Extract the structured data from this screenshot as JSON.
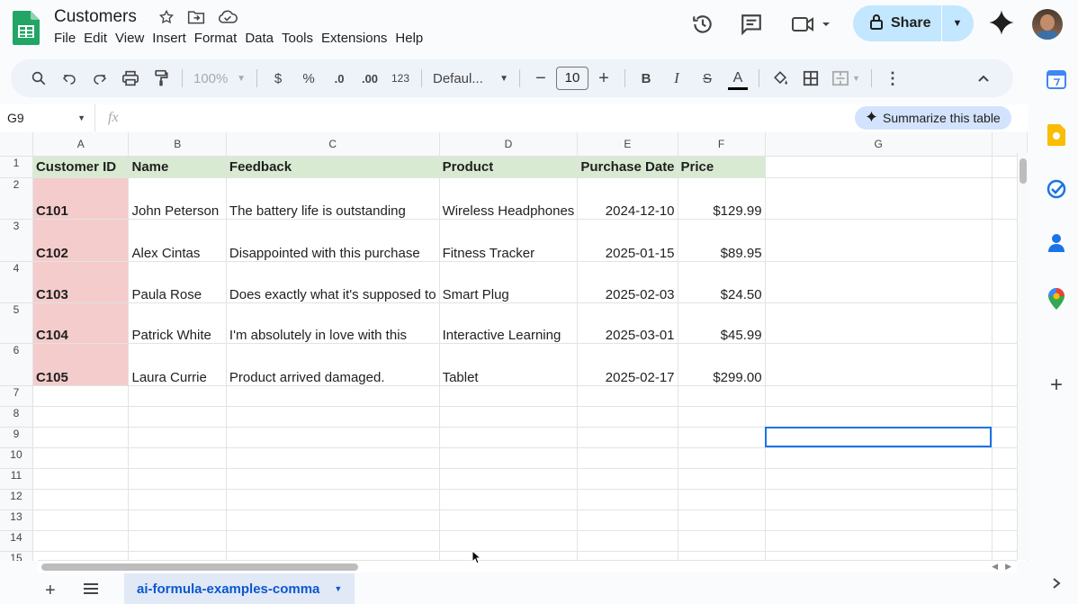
{
  "app": {
    "doc_title": "Customers",
    "menu": [
      "File",
      "Edit",
      "View",
      "Insert",
      "Format",
      "Data",
      "Tools",
      "Extensions",
      "Help"
    ],
    "share_label": "Share"
  },
  "toolbar": {
    "zoom": "100%",
    "currency": "$",
    "percent": "%",
    "dec_decrease": ".0",
    "dec_increase": ".00",
    "number_format": "123",
    "font": "Defaul...",
    "font_size": "10",
    "bold": "B",
    "italic": "I",
    "strike": "S",
    "text_color": "A"
  },
  "formula_bar": {
    "cell_ref": "G9",
    "fx": "fx",
    "summarize_label": "Summarize this table"
  },
  "grid": {
    "columns": [
      "A",
      "B",
      "C",
      "D",
      "E",
      "F",
      "G"
    ],
    "selected_column": "G",
    "selected_row": "9",
    "header": [
      "Customer ID",
      "Name",
      "Feedback",
      "Product",
      "Purchase Date",
      "Price"
    ],
    "rows": [
      [
        "C101",
        "John Peterson",
        "The battery life is outstanding",
        "Wireless Headphones",
        "2024-12-10",
        "$129.99"
      ],
      [
        "C102",
        "Alex Cintas",
        "Disappointed with this purchase",
        "Fitness Tracker",
        "2025-01-15",
        "$89.95"
      ],
      [
        "C103",
        "Paula Rose",
        "Does exactly what it's supposed to",
        "Smart Plug",
        "2025-02-03",
        "$24.50"
      ],
      [
        "C104",
        "Patrick White",
        "I'm absolutely in love with this",
        "Interactive Learning",
        "2025-03-01",
        "$45.99"
      ],
      [
        "C105",
        "Laura Currie",
        "Product arrived damaged.",
        "Tablet",
        "2025-02-17",
        "$299.00"
      ]
    ],
    "row_numbers": [
      "1",
      "2",
      "3",
      "4",
      "5",
      "6",
      "7",
      "8",
      "9",
      "10",
      "11",
      "12",
      "13",
      "14",
      "15"
    ]
  },
  "sheets": {
    "active_tab": "ai-formula-examples-comma"
  },
  "colors": {
    "header_fill": "#d9ead3",
    "id_fill": "#f4cccc",
    "selection": "#1a73e8",
    "share_bg": "#c2e7ff"
  }
}
